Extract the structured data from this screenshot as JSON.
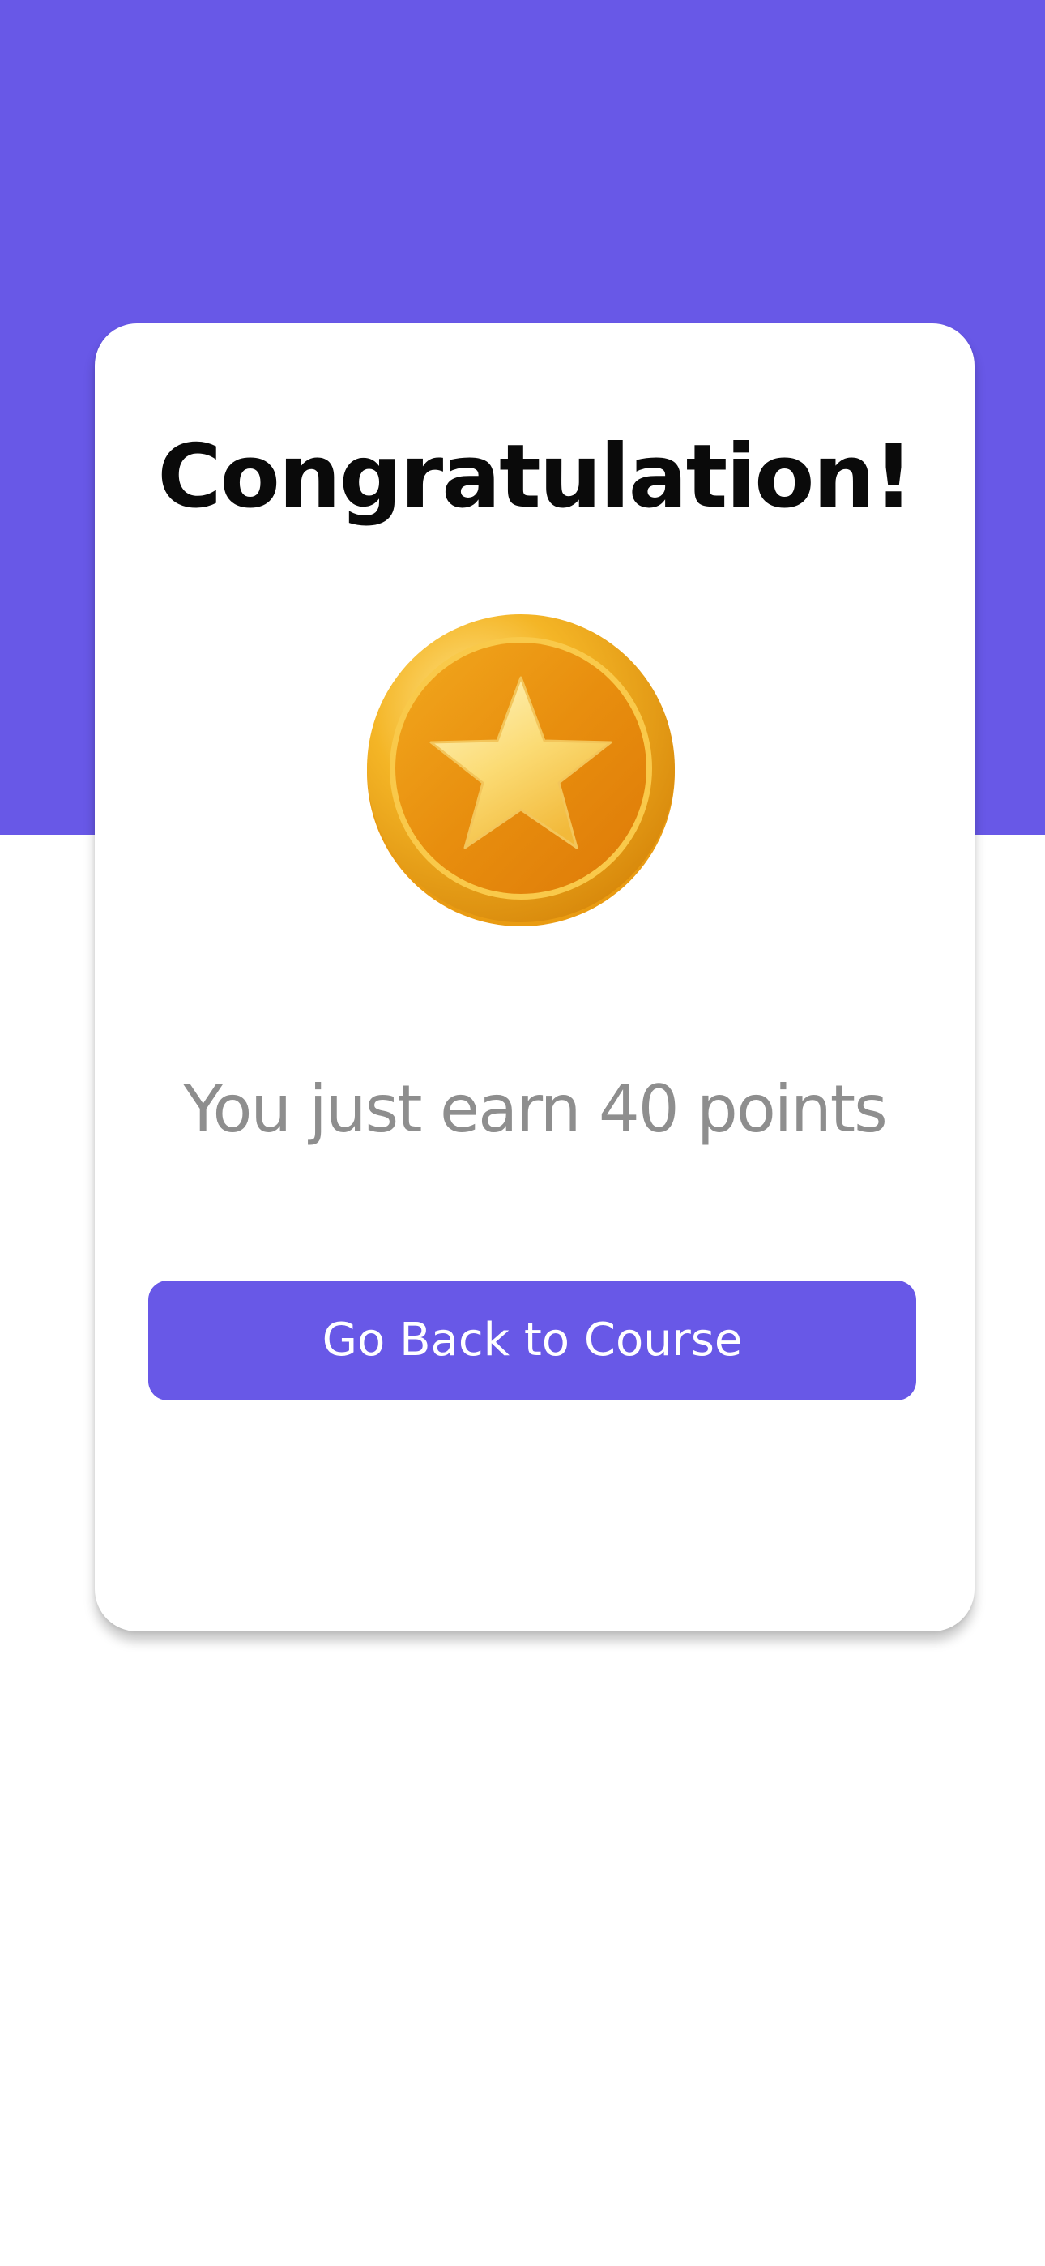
{
  "theme": {
    "accent_color": "#6858E7",
    "title_color": "#0a0a0a",
    "subtitle_color": "#8e8e8e",
    "button_text_color": "#ffffff"
  },
  "modal": {
    "title": "Congratulation!",
    "icon": "gold-star-medal-icon",
    "message": "You just earn 40 points",
    "primary_button_label": "Go Back to Course"
  }
}
